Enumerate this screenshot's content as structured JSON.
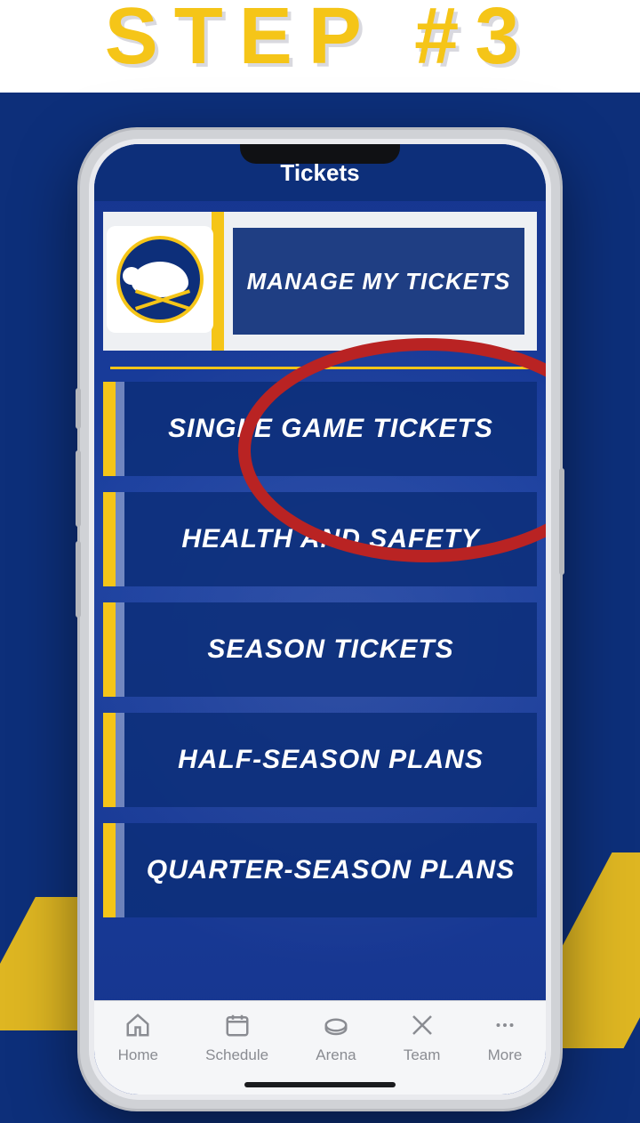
{
  "banner": {
    "title": "STEP #3"
  },
  "screen": {
    "topbar_title": "Tickets",
    "hero": {
      "manage_label": "MANAGE MY TICKETS"
    },
    "options": [
      {
        "label": "SINGLE GAME TICKETS"
      },
      {
        "label": "HEALTH AND SAFETY"
      },
      {
        "label": "SEASON TICKETS"
      },
      {
        "label": "HALF-SEASON PLANS"
      },
      {
        "label": "QUARTER-SEASON PLANS"
      }
    ],
    "tabs": [
      {
        "label": "Home"
      },
      {
        "label": "Schedule"
      },
      {
        "label": "Arena"
      },
      {
        "label": "Team"
      },
      {
        "label": "More"
      }
    ]
  },
  "colors": {
    "brand_blue": "#0d2f7a",
    "brand_gold": "#f5c518",
    "callout_red": "#b92323"
  }
}
